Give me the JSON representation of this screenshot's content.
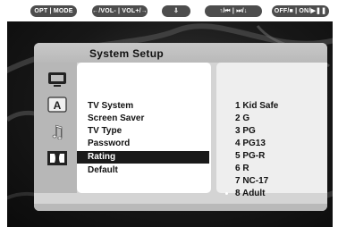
{
  "hint_bar": {
    "buttons": [
      {
        "label": "OPT | MODE"
      },
      {
        "label": "←/VOL- | VOL+/→"
      },
      {
        "label": "⇩"
      },
      {
        "label": "↑/⏮ | ⏭/↓"
      },
      {
        "label": "OFF/■ | ON/▶❚❚"
      }
    ]
  },
  "menu": {
    "title": "System Setup",
    "category_icons": [
      "tv-icon",
      "subtitle-a-icon",
      "music-note-icon",
      "dolby-icon"
    ],
    "items": [
      {
        "label": "TV System"
      },
      {
        "label": "Screen Saver"
      },
      {
        "label": "TV Type"
      },
      {
        "label": "Password"
      },
      {
        "label": "Rating"
      },
      {
        "label": "Default"
      }
    ],
    "selected_item": "Rating",
    "options": [
      {
        "label": "1 Kid Safe"
      },
      {
        "label": "2 G"
      },
      {
        "label": "3 PG"
      },
      {
        "label": "4 PG13"
      },
      {
        "label": "5 PG-R"
      },
      {
        "label": "6 R"
      },
      {
        "label": "7 NC-17"
      },
      {
        "label": "8 Adult"
      }
    ],
    "current_option": "8 Adult"
  },
  "colors": {
    "screen_background": "#171717",
    "panel": "#d4d4d4",
    "selection": "#1a1a1a",
    "pill": "#4d4d4d"
  }
}
